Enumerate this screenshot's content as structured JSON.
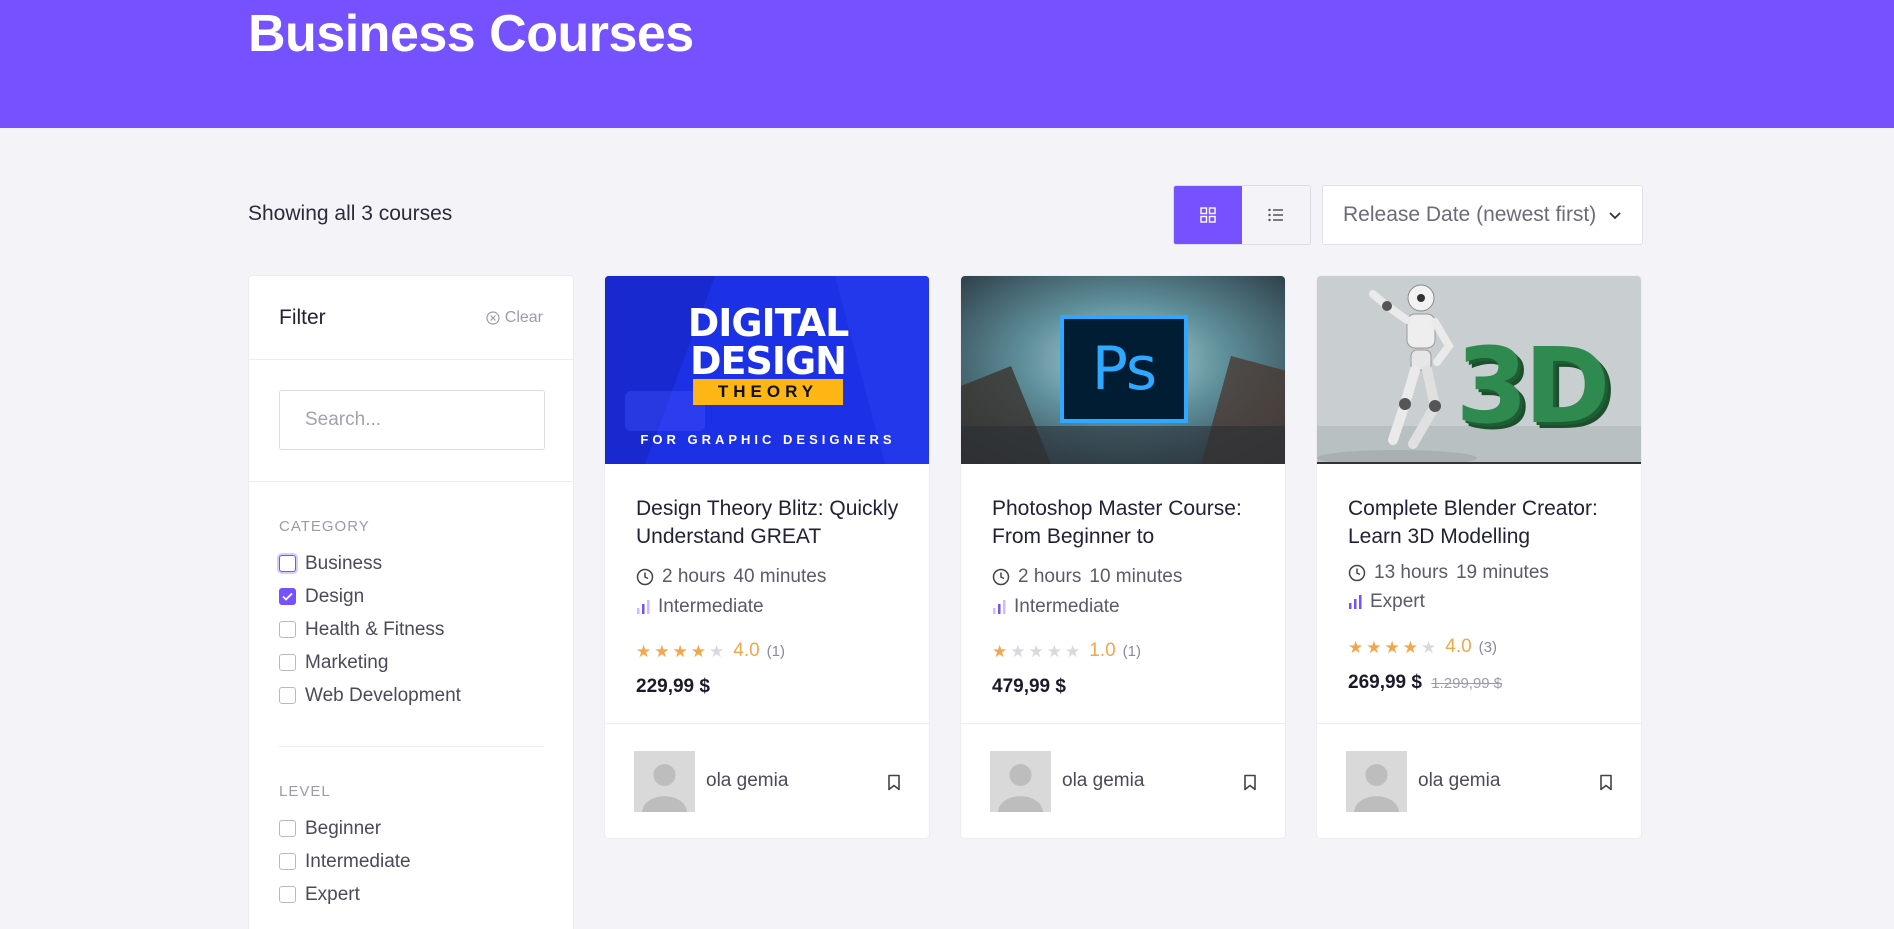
{
  "page": {
    "title": "Business Courses"
  },
  "toolbar": {
    "showing": "Showing all 3 courses",
    "sort_value": "Release Date (newest first)",
    "views": [
      "grid-icon",
      "list-icon"
    ]
  },
  "filter": {
    "title": "Filter",
    "clear": "Clear",
    "search_placeholder": "Search...",
    "category": {
      "title": "CATEGORY",
      "items": [
        {
          "label": "Business",
          "checked": false
        },
        {
          "label": "Design",
          "checked": true
        },
        {
          "label": "Health & Fitness",
          "checked": false
        },
        {
          "label": "Marketing",
          "checked": false
        },
        {
          "label": "Web Development",
          "checked": false
        }
      ]
    },
    "level": {
      "title": "LEVEL",
      "items": [
        {
          "label": "Beginner",
          "checked": false
        },
        {
          "label": "Intermediate",
          "checked": false
        },
        {
          "label": "Expert",
          "checked": false
        }
      ]
    }
  },
  "courses": [
    {
      "title": "Design Theory Blitz: Quickly Understand GREAT",
      "thumb": {
        "line1": "DIGITAL",
        "line2": "DESIGN",
        "badge": "THEORY",
        "tagline": "FOR GRAPHIC DESIGNERS"
      },
      "hours": "2 hours",
      "minutes": "40 minutes",
      "level": "Intermediate",
      "rating": 4,
      "score": "4.0",
      "reviews": "(1)",
      "price": "229,99 $",
      "old_price": "",
      "author": "ola gemia"
    },
    {
      "title": "Photoshop Master Course: From Beginner to",
      "thumb": {
        "logo": "Ps"
      },
      "hours": "2 hours",
      "minutes": "10 minutes",
      "level": "Intermediate",
      "rating": 1,
      "score": "1.0",
      "reviews": "(1)",
      "price": "479,99 $",
      "old_price": "",
      "author": "ola gemia"
    },
    {
      "title": "Complete Blender Creator: Learn 3D Modelling",
      "thumb": {
        "logo": "3D"
      },
      "hours": "13 hours",
      "minutes": "19 minutes",
      "level": "Expert",
      "rating": 4,
      "score": "4.0",
      "reviews": "(3)",
      "price": "269,99 $",
      "old_price": "1.299,99 $",
      "author": "ola gemia"
    }
  ],
  "colors": {
    "accent": "#7551ff",
    "star": "#f5a54a",
    "background": "#f4f4f8"
  }
}
